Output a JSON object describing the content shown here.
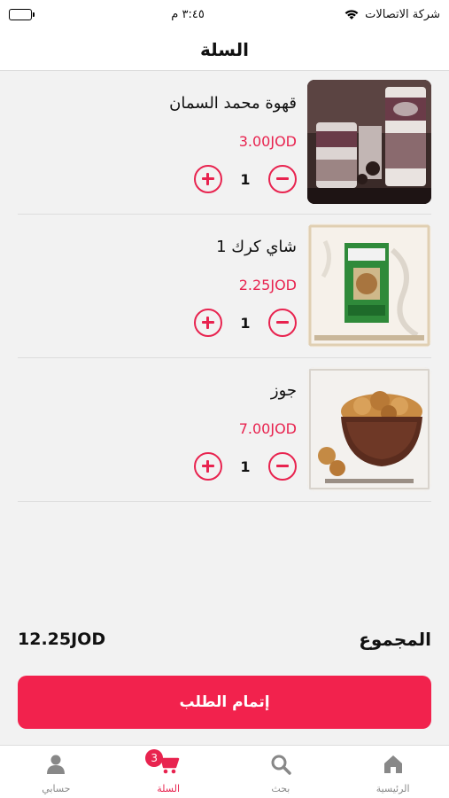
{
  "status_bar": {
    "carrier": "شركة الاتصالات",
    "time": "٣:٤٥ م"
  },
  "header": {
    "title": "السلة"
  },
  "cart": {
    "items": [
      {
        "name": "قهوة محمد السمان",
        "price": "3.00JOD",
        "quantity": "1",
        "image": "coffee-cans"
      },
      {
        "name": "شاي كرك 1",
        "price": "2.25JOD",
        "quantity": "1",
        "image": "karak-tea-box"
      },
      {
        "name": "جوز",
        "price": "7.00JOD",
        "quantity": "1",
        "image": "walnuts-bowl"
      }
    ]
  },
  "summary": {
    "total_label": "المجموع",
    "total_amount": "12.25JOD"
  },
  "checkout": {
    "label": "إتمام الطلب"
  },
  "tab_bar": {
    "tabs": [
      {
        "label": "الرئيسية",
        "icon": "home-icon"
      },
      {
        "label": "بحث",
        "icon": "search-icon"
      },
      {
        "label": "السلة",
        "icon": "cart-icon",
        "badge": "3",
        "active": true
      },
      {
        "label": "حسابي",
        "icon": "user-icon"
      }
    ]
  },
  "colors": {
    "accent": "#e8234f",
    "button": "#f2224d",
    "background": "#f2f2f2"
  }
}
